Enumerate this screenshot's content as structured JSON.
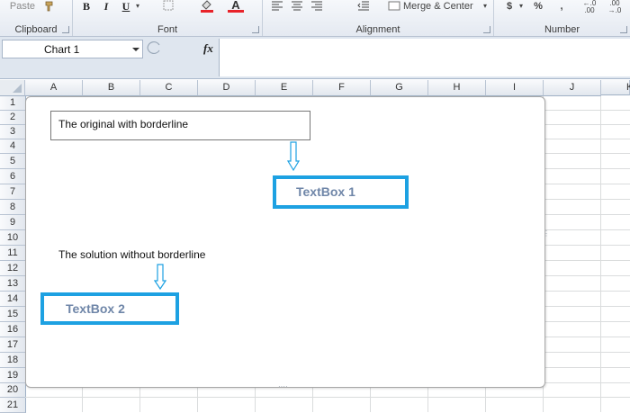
{
  "ribbon": {
    "paste_label": "Paste",
    "groups": [
      {
        "label": "Clipboard"
      },
      {
        "label": "Font"
      },
      {
        "label": "Alignment"
      },
      {
        "label": "Number"
      }
    ],
    "font_buttons": {
      "bold": "B",
      "italic": "I",
      "underline": "U"
    },
    "font_color_letter": "A",
    "merge_label": "Merge & Center",
    "currency": "$",
    "percent": "%",
    "comma": ",",
    "decimal_increase": "←.0\n.00",
    "decimal_decrease": ".00\n→.0"
  },
  "formula_bar": {
    "name_box": "Chart 1",
    "fx": "fx",
    "value": ""
  },
  "sheet": {
    "columns": [
      "A",
      "B",
      "C",
      "D",
      "E",
      "F",
      "G",
      "H",
      "I",
      "J",
      "K"
    ],
    "rows": [
      "1",
      "2",
      "3",
      "4",
      "5",
      "6",
      "7",
      "8",
      "9",
      "10",
      "11",
      "12",
      "13",
      "14",
      "15",
      "16",
      "17",
      "18",
      "19",
      "20",
      "21"
    ]
  },
  "chart": {
    "original_text": "The original with borderline",
    "textbox1_label": "TextBox 1",
    "solution_text": "The solution without borderline",
    "textbox2_label": "TextBox 2",
    "accent_color": "#1da1e2",
    "arrow_color": "#1da1e2"
  }
}
